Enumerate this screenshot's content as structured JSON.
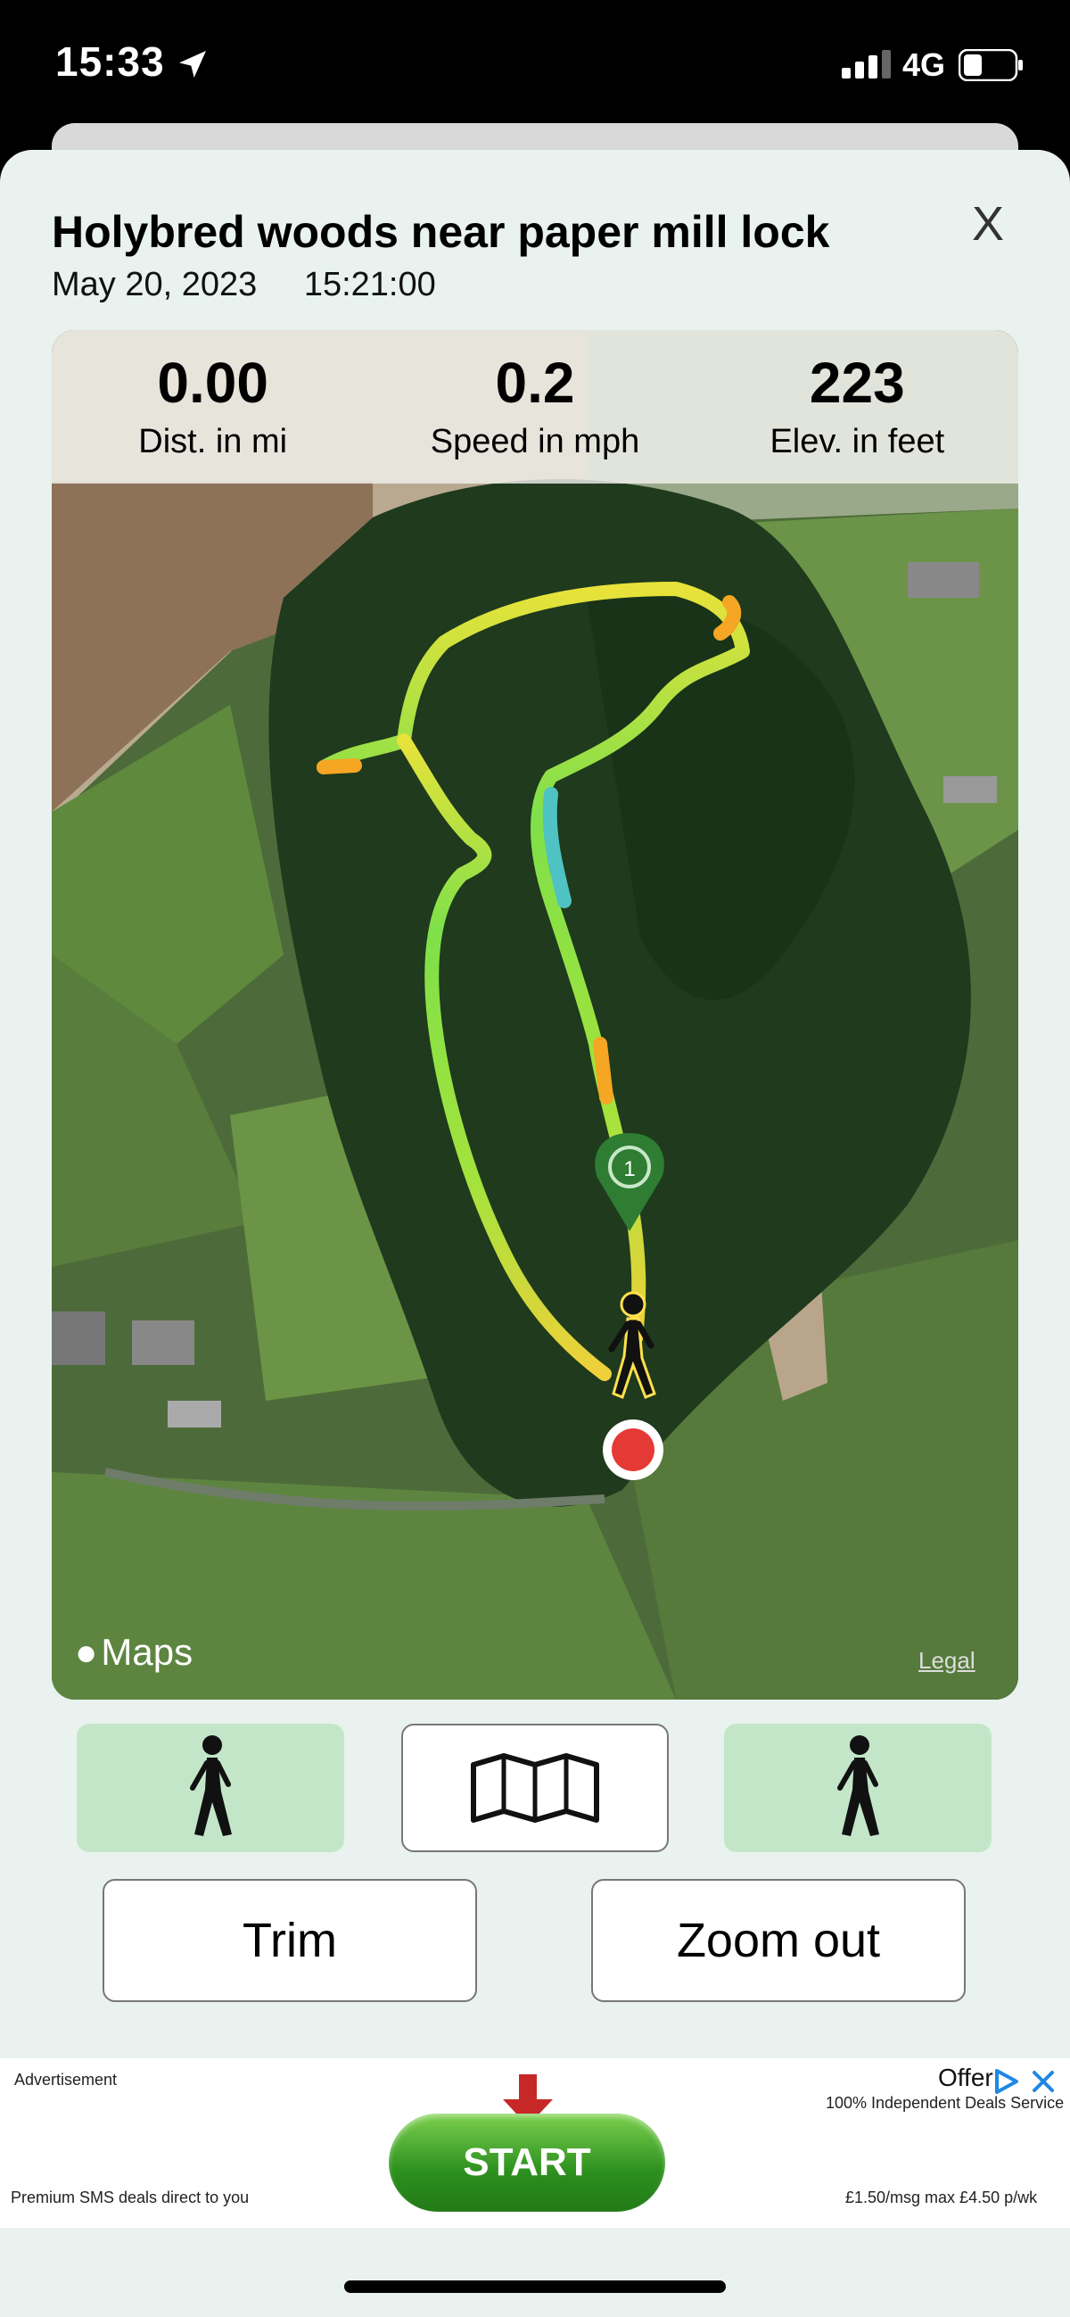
{
  "status_bar": {
    "time": "15:33",
    "network": "4G",
    "icons": [
      "location-arrow-icon",
      "signal-icon",
      "battery-icon"
    ]
  },
  "header": {
    "title": "Holybred woods near paper mill lock",
    "date": "May 20, 2023",
    "time": "15:21:00",
    "close_label": "X"
  },
  "stats": [
    {
      "value": "0.00",
      "label": "Dist. in mi"
    },
    {
      "value": "0.2",
      "label": "Speed in mph"
    },
    {
      "value": "223",
      "label": "Elev. in feet"
    }
  ],
  "map": {
    "attribution": "Maps",
    "legal": "Legal",
    "marker_label": "1"
  },
  "mode_buttons": [
    {
      "icon": "walker-icon"
    },
    {
      "icon": "map-icon"
    },
    {
      "icon": "walker-icon"
    }
  ],
  "actions": {
    "trim": "Trim",
    "zoom_out": "Zoom out"
  },
  "ad": {
    "label": "Advertisement",
    "offer": "Offer",
    "sub": "100% Independent Deals Service",
    "cta": "START",
    "left_text": "Premium SMS deals direct to you",
    "right_text": "£1.50/msg max £4.50 p/wk"
  },
  "colors": {
    "sheet_bg": "#e9f2ef",
    "mode_green": "#c3e6c9",
    "marker_green": "#2e7d32",
    "end_red": "#e53935"
  }
}
